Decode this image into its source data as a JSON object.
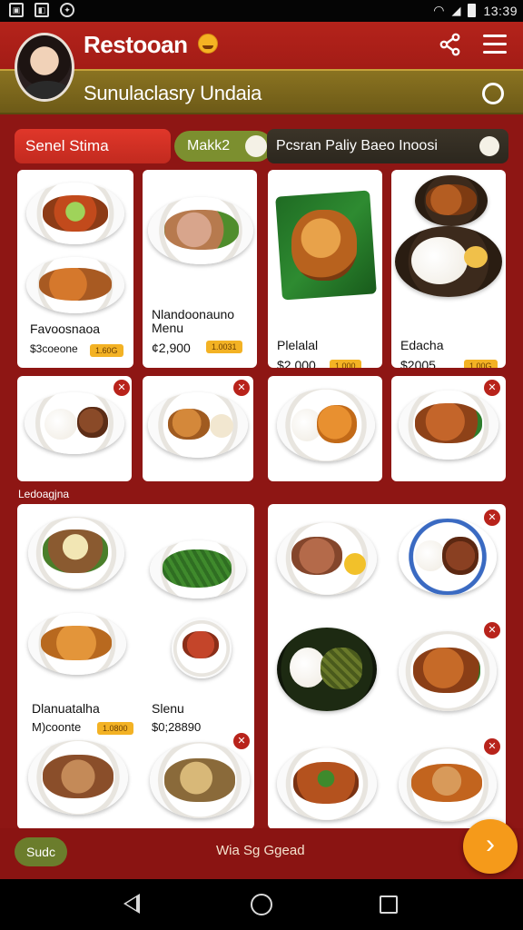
{
  "status_bar": {
    "time": "13:39",
    "icons": [
      "gallery-icon",
      "notification-icon",
      "game-icon"
    ],
    "right_icons": [
      "wifi-icon",
      "signal-icon",
      "battery-icon"
    ]
  },
  "header": {
    "title": "Restooan",
    "subtitle": "Sunulaclasry Undaia"
  },
  "tabs": {
    "primary": "Senel Stima",
    "secondary": "Makk2",
    "tertiary": "Pcsran Paliy Baeo Inoosi"
  },
  "menu_top": [
    {
      "title": "Favoosnaoa",
      "price": "$3coeone",
      "badge": "1.60G"
    },
    {
      "title": "Nlandoonauno Menu",
      "price": "¢2,900",
      "badge": "1.0031"
    },
    {
      "title": "Plelalal",
      "price": "$2,000",
      "badge": "1.000"
    },
    {
      "title": "Edacha",
      "price": "$2005",
      "badge": "1.00G"
    }
  ],
  "section_label": "Ledoagjna",
  "lower_left": [
    {
      "title": "Dlanuatalha",
      "price": "M)coonte",
      "badge": "1.0800"
    },
    {
      "title": "Slenu",
      "price": "$0;28890"
    }
  ],
  "bottom": {
    "sub_button": "Sudc",
    "center_text": "Wia Sg Ggead"
  },
  "accent_colors": {
    "header": "#b4231b",
    "olive": "#8a7321",
    "badge": "#f3b224",
    "fab": "#f59a1a"
  }
}
